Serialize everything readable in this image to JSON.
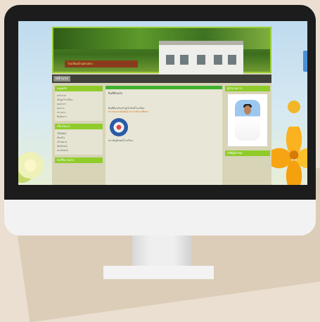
{
  "monitor": {
    "screen_bg": "#c9e1ef"
  },
  "site": {
    "banner_sign": "โรงเรียนบ้านตัวอย่าง",
    "nav": {
      "home_label": "หน้าแรก"
    },
    "left_boxes": [
      {
        "title": "เมนูหลัก",
        "items": [
          "หน้าแรก",
          "ข้อมูลโรงเรียน",
          "บุคลากร",
          "ผลงาน",
          "ข่าวสาร",
          "ติดต่อเรา"
        ]
      },
      {
        "title": "เกี่ยวกับเรา",
        "items": [
          "วิสัยทัศน์",
          "พันธกิจ",
          "เป้าหมาย",
          "อัตลักษณ์",
          "เอกลักษณ์"
        ]
      },
      {
        "title": "ลิงก์ที่น่าสนใจ",
        "items": []
      }
    ],
    "mid": {
      "title": "ยินดีต้อนรับ",
      "text1": "ยินดีต้อนรับเข้าสู่เว็บไซต์โรงเรียน",
      "orange": "ข่าวประชาสัมพันธ์ ประจำปีการศึกษา",
      "caption": "ตราสัญลักษณ์โรงเรียน"
    },
    "right_boxes": [
      {
        "title": "ผู้อำนวยการ"
      },
      {
        "title": "สถิติผู้เข้าชม"
      }
    ]
  }
}
